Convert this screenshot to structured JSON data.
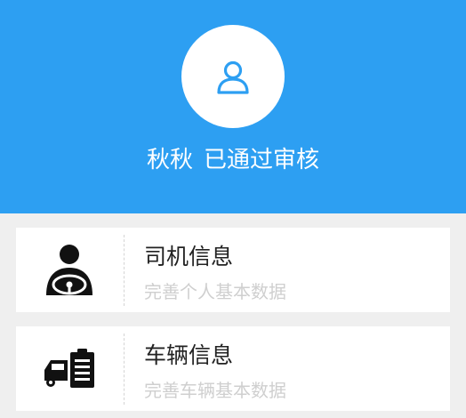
{
  "colors": {
    "header_bg": "#2d9ff2",
    "page_bg": "#efefef",
    "card_bg": "#ffffff",
    "title_text": "#222222",
    "subtitle_text": "#cfcfcf"
  },
  "profile": {
    "avatar_icon": "user-icon",
    "name": "秋秋",
    "status": "已通过审核"
  },
  "cards": [
    {
      "icon": "driver-icon",
      "title": "司机信息",
      "subtitle": "完善个人基本数据"
    },
    {
      "icon": "vehicle-icon",
      "title": "车辆信息",
      "subtitle": "完善车辆基本数据"
    }
  ]
}
